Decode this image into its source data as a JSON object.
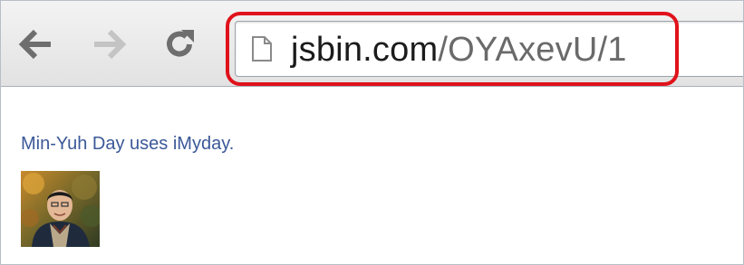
{
  "browser": {
    "url_host": "jsbin.com",
    "url_path": "/OYAxevU/1",
    "highlight_color": "#e0121b"
  },
  "icons": {
    "back": "back-arrow-icon",
    "forward": "forward-arrow-icon",
    "reload": "reload-icon",
    "page": "page-icon"
  },
  "page": {
    "status_text": "Min-Yuh Day uses iMyday.",
    "link_color": "#3b5998"
  }
}
